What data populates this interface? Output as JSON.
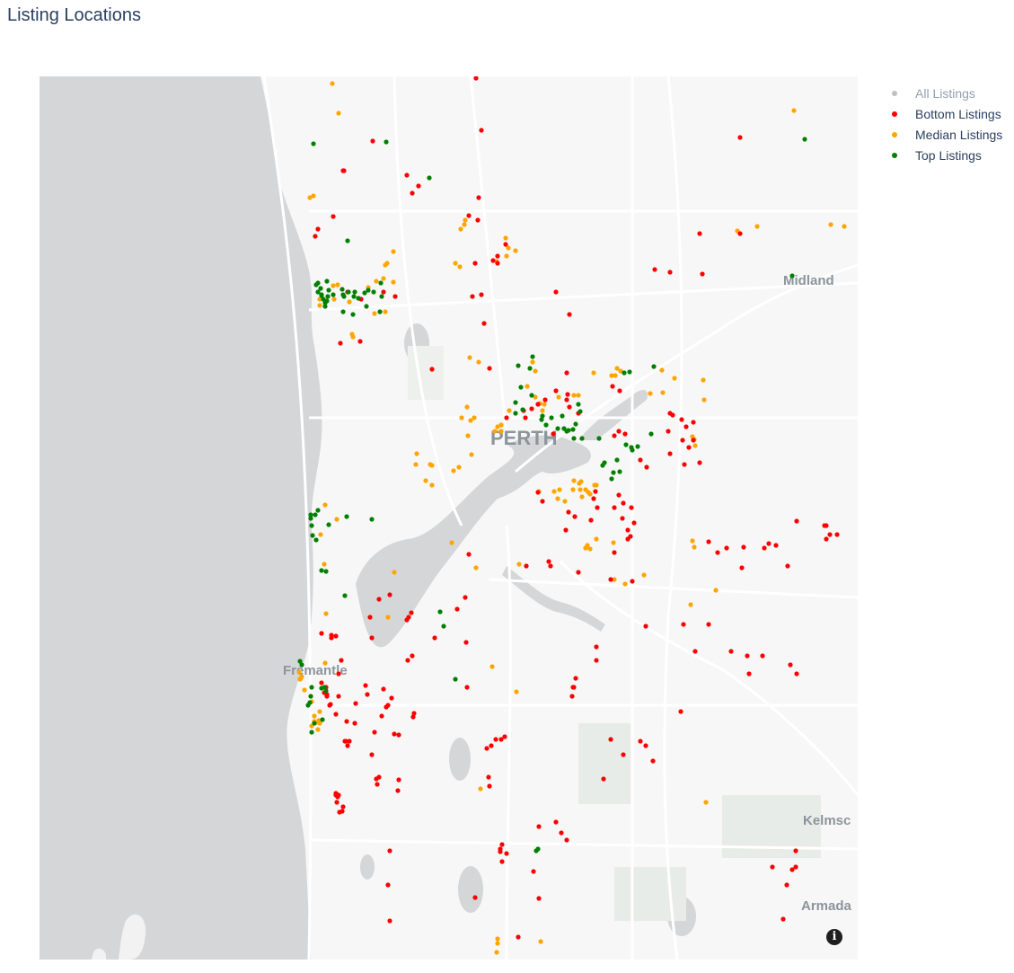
{
  "title": "Listing Locations",
  "legend": [
    {
      "label": "All Listings",
      "color": "#7f7f7f",
      "visible": false
    },
    {
      "label": "Bottom Listings",
      "color": "#ff0000",
      "visible": true
    },
    {
      "label": "Median Listings",
      "color": "#ffa500",
      "visible": true
    },
    {
      "label": "Top Listings",
      "color": "#008000",
      "visible": true
    }
  ],
  "map": {
    "place_labels": [
      "Midland",
      "PERTH",
      "Fremantle",
      "Kelmsc",
      "Armada"
    ],
    "info_icon": "info-icon"
  }
}
